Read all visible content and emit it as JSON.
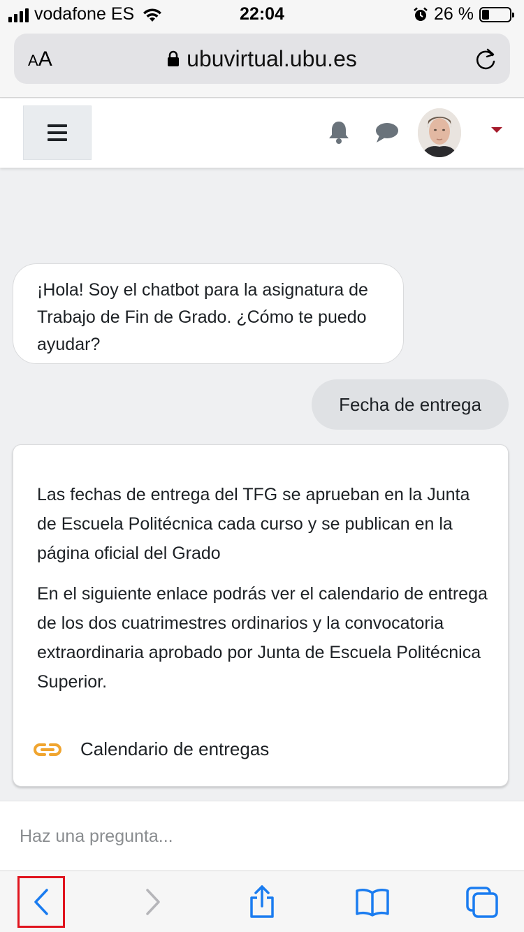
{
  "status_bar": {
    "carrier": "vodafone ES",
    "time": "22:04",
    "battery_percent_label": "26 %",
    "battery_level": 0.26,
    "icons": [
      "signal-icon",
      "wifi-icon",
      "alarm-icon",
      "battery-icon"
    ]
  },
  "browser": {
    "text_size_label_small": "A",
    "text_size_label_large": "A",
    "url": "ubuvirtual.ubu.es",
    "icons": [
      "lock-icon",
      "reload-icon"
    ]
  },
  "site_header": {
    "icons": [
      "hamburger-menu-icon",
      "bell-icon",
      "chat-icon",
      "dropdown-caret-icon"
    ],
    "accent_color": "#a51a2b"
  },
  "chat": {
    "bot_greeting": "¡Hola! Soy el chatbot para la asignatura de Trabajo de Fin de Grado. ¿Cómo te puedo ayudar?",
    "user_message": "Fecha de entrega",
    "answer_paragraph_1": "Las fechas de entrega del TFG se aprueban en la Junta de Escuela Politécnica cada curso y se publican en la página oficial del Grado",
    "answer_paragraph_2": "En el siguiente enlace podrás ver el calendario de entrega de los dos cuatrimestres ordinarios y la convocatoria extraordinaria aprobado por Junta de Escuela Politécnica Superior.",
    "link_label": "Calendario de entregas",
    "link_icon_color": "#f0a530"
  },
  "input": {
    "placeholder": "Haz una pregunta..."
  },
  "toolbar": {
    "icons": [
      "back-icon",
      "forward-icon",
      "share-icon",
      "bookmarks-icon",
      "tabs-icon"
    ],
    "ios_blue": "#1a7cf0",
    "highlight_color": "#e0141e"
  }
}
